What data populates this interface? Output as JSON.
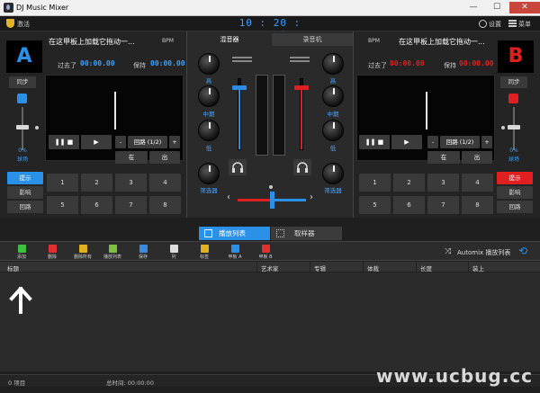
{
  "window": {
    "title": "DJ Music Mixer",
    "minimize": "—",
    "maximize": "☐",
    "close": "✕"
  },
  "topbar": {
    "activate": "激活",
    "clock": "10 : 20 : 48 上午",
    "settings": "设置",
    "menu": "菜单"
  },
  "deck_a": {
    "letter": "A",
    "color": "#2a90e8",
    "track": "在这甲板上加载它拖动一...",
    "bpm": "BPM",
    "elapsed_label": "过去了",
    "elapsed": "00:00.00",
    "remain_label": "保持",
    "remain": "00:00.00",
    "sync": "同步",
    "pitch_pct": "0%",
    "pitch_mode": "球场",
    "minus": "-",
    "loop": "回路 (1/2)",
    "plus": "+",
    "in": "在",
    "out": "出",
    "cues": [
      "1",
      "2",
      "3",
      "4",
      "5",
      "6",
      "7",
      "8"
    ],
    "side": [
      "提示",
      "影响",
      "回路"
    ]
  },
  "deck_b": {
    "letter": "B",
    "color": "#e02020",
    "track": "在这甲板上加载它拖动一...",
    "bpm": "BPM",
    "elapsed_label": "过去了",
    "elapsed": "00:00.00",
    "remain_label": "保持",
    "remain": "00:00.00",
    "sync": "同步",
    "pitch_pct": "0%",
    "pitch_mode": "球场",
    "minus": "-",
    "loop": "回路 (1/2)",
    "plus": "+",
    "in": "在",
    "out": "出",
    "cues": [
      "1",
      "2",
      "3",
      "4",
      "5",
      "6",
      "7",
      "8"
    ],
    "side": [
      "提示",
      "影响",
      "回路"
    ]
  },
  "mixer": {
    "tabs": [
      "混音器",
      "录音机"
    ],
    "left_knobs": [
      "高",
      "中期",
      "低",
      "筛选器"
    ],
    "right_knobs": [
      "高",
      "中期",
      "低",
      "筛选器"
    ],
    "left_volume": 0.88,
    "right_volume": 0.88,
    "crossfader": 0.5
  },
  "tabs": {
    "playlist": "播放列表",
    "sampler": "取样器"
  },
  "toolbar": {
    "items": [
      {
        "label": "添加",
        "icon": "add-icon",
        "color": "#3fbf3f"
      },
      {
        "label": "删除",
        "icon": "delete-icon",
        "color": "#e03030"
      },
      {
        "label": "删除所有",
        "icon": "delete-all-icon",
        "color": "#e0b020"
      },
      {
        "label": "播放列表",
        "icon": "playlist-icon",
        "color": "#7fbf3f"
      },
      {
        "label": "保存",
        "icon": "save-icon",
        "color": "#3a8ae0"
      },
      {
        "label": "列",
        "icon": "columns-icon",
        "color": "#dddddd"
      },
      {
        "label": "标签",
        "icon": "tag-icon",
        "color": "#e0b020"
      },
      {
        "label": "甲板 A",
        "icon": "deck-a-icon",
        "color": "#2a90e8"
      },
      {
        "label": "甲板 B",
        "icon": "deck-b-icon",
        "color": "#e03030"
      }
    ],
    "automix": "Automix 播放列表"
  },
  "table": {
    "columns": [
      "标题",
      "艺术家",
      "专辑",
      "体裁",
      "长度",
      "装上"
    ]
  },
  "status": {
    "items": "0 项目",
    "total": "总时间: 00:00:00"
  },
  "watermark": "www.ucbug.cc"
}
